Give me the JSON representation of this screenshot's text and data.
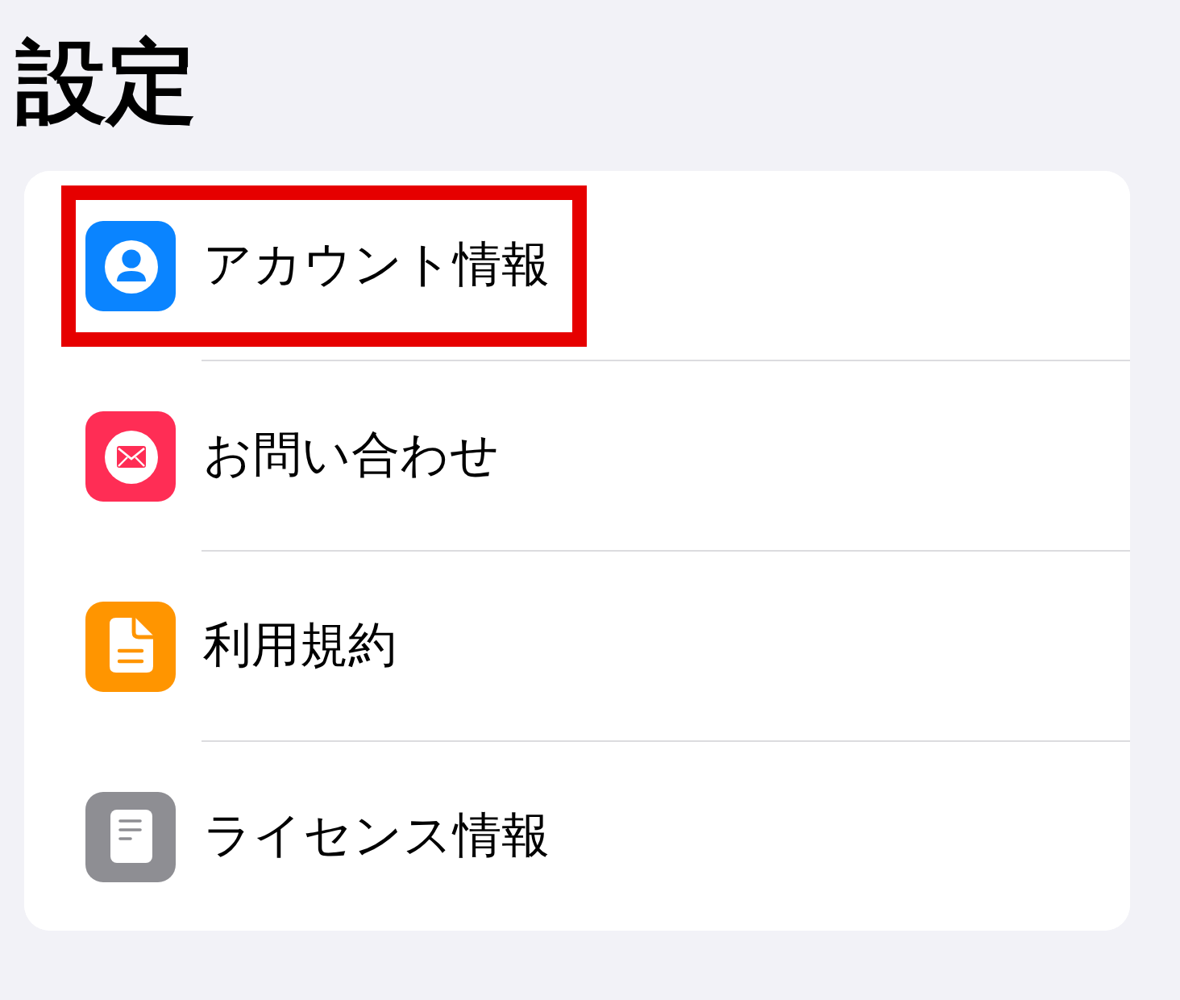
{
  "title": "設定",
  "items": [
    {
      "label": "アカウント情報",
      "kind": "account",
      "color": "#0a84ff",
      "highlighted": true
    },
    {
      "label": "お問い合わせ",
      "kind": "contact",
      "color": "#ff2d55",
      "highlighted": false
    },
    {
      "label": "利用規約",
      "kind": "terms",
      "color": "#ff9500",
      "highlighted": false
    },
    {
      "label": "ライセンス情報",
      "kind": "license",
      "color": "#8e8e93",
      "highlighted": false
    }
  ]
}
